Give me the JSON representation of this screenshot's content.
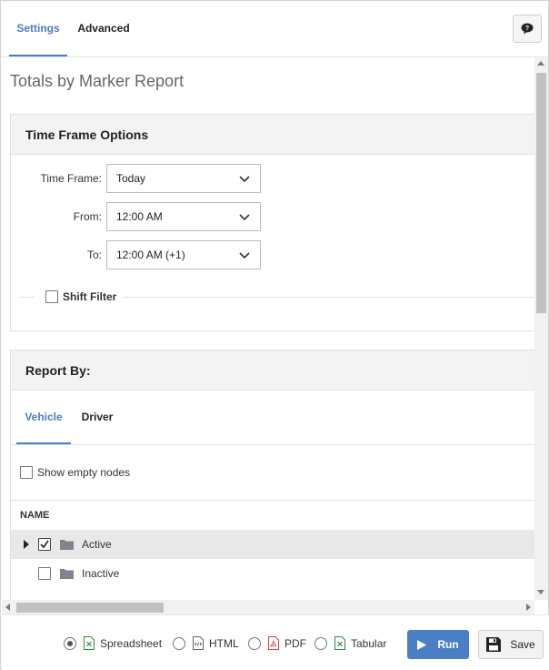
{
  "tabs": [
    {
      "label": "Settings",
      "active": true
    },
    {
      "label": "Advanced",
      "active": false
    }
  ],
  "help_icon": "speech-bubble-question-icon",
  "page_title": "Totals by Marker Report",
  "time_frame_panel": {
    "title": "Time Frame Options",
    "fields": [
      {
        "label": "Time Frame:",
        "value": "Today"
      },
      {
        "label": "From:",
        "value": "12:00 AM"
      },
      {
        "label": "To:",
        "value": "12:00 AM (+1)"
      }
    ],
    "shift_filter": {
      "label": "Shift Filter",
      "checked": false
    }
  },
  "report_by_panel": {
    "title": "Report By:",
    "tabs": [
      {
        "label": "Vehicle",
        "active": true
      },
      {
        "label": "Driver",
        "active": false
      }
    ],
    "show_empty_nodes": {
      "label": "Show empty nodes",
      "checked": false
    },
    "tree": {
      "column_header": "NAME",
      "rows": [
        {
          "label": "Active",
          "checked": true,
          "expandable": true,
          "selected": true
        },
        {
          "label": "Inactive",
          "checked": false,
          "expandable": false,
          "selected": false
        }
      ]
    }
  },
  "footer": {
    "formats": [
      {
        "label": "Spreadsheet",
        "selected": true,
        "icon": "excel-file-icon"
      },
      {
        "label": "HTML",
        "selected": false,
        "icon": "html-file-icon"
      },
      {
        "label": "PDF",
        "selected": false,
        "icon": "pdf-file-icon"
      },
      {
        "label": "Tabular",
        "selected": false,
        "icon": "excel-file-icon"
      }
    ],
    "run_label": "Run",
    "save_label": "Save"
  },
  "colors": {
    "accent": "#4a7ec5",
    "excel": "#2e8b3e",
    "pdf": "#d9443a"
  }
}
